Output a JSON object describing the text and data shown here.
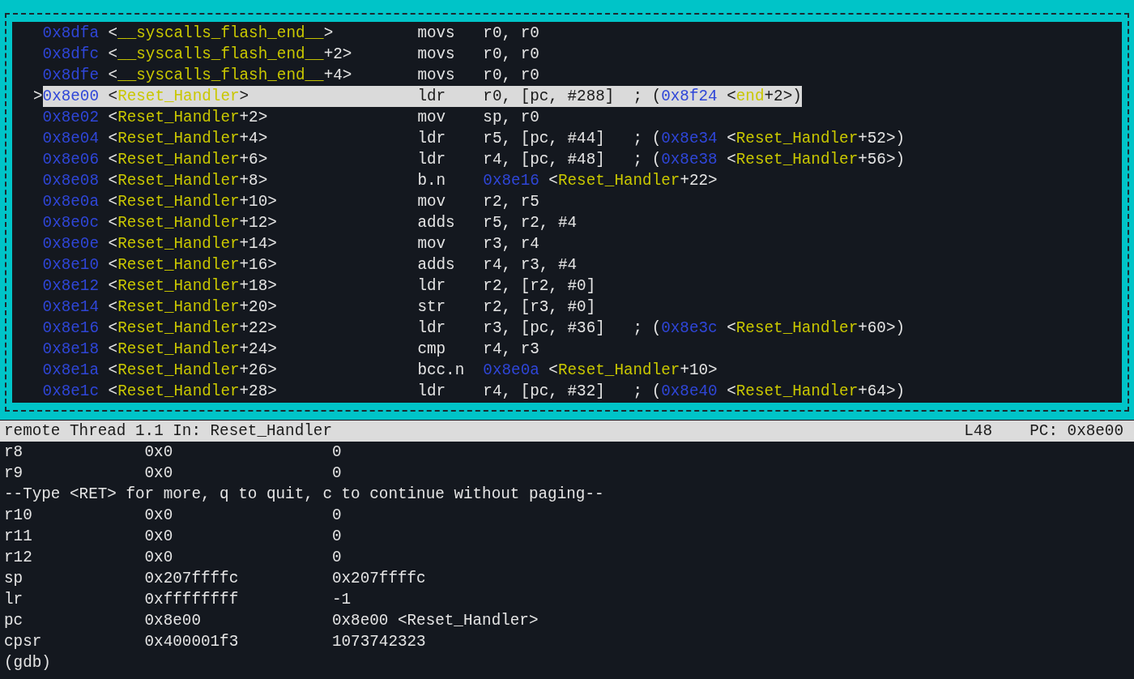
{
  "disassembly": {
    "pointer": ">",
    "rows": [
      {
        "current": false,
        "address": "0x8dfa",
        "symbol": [
          {
            "text": "<",
            "kind": "plain"
          },
          {
            "text": "__syscalls_flash_end__",
            "kind": "sym"
          },
          {
            "text": ">",
            "kind": "plain"
          }
        ],
        "mnemonic": "movs",
        "operands": [
          {
            "text": "r0, r0",
            "kind": "plain"
          }
        ]
      },
      {
        "current": false,
        "address": "0x8dfc",
        "symbol": [
          {
            "text": "<",
            "kind": "plain"
          },
          {
            "text": "__syscalls_flash_end__",
            "kind": "sym"
          },
          {
            "text": "+2>",
            "kind": "plain"
          }
        ],
        "mnemonic": "movs",
        "operands": [
          {
            "text": "r0, r0",
            "kind": "plain"
          }
        ]
      },
      {
        "current": false,
        "address": "0x8dfe",
        "symbol": [
          {
            "text": "<",
            "kind": "plain"
          },
          {
            "text": "__syscalls_flash_end__",
            "kind": "sym"
          },
          {
            "text": "+4>",
            "kind": "plain"
          }
        ],
        "mnemonic": "movs",
        "operands": [
          {
            "text": "r0, r0",
            "kind": "plain"
          }
        ]
      },
      {
        "current": true,
        "address": "0x8e00",
        "symbol": [
          {
            "text": "<",
            "kind": "plain"
          },
          {
            "text": "Reset_Handler",
            "kind": "sym"
          },
          {
            "text": ">",
            "kind": "plain"
          }
        ],
        "mnemonic": "ldr",
        "operands": [
          {
            "text": "r0, [pc, #288]  ; (",
            "kind": "plain"
          },
          {
            "text": "0x8f24",
            "kind": "addr"
          },
          {
            "text": " <",
            "kind": "plain"
          },
          {
            "text": "end",
            "kind": "sym"
          },
          {
            "text": "+2>)",
            "kind": "plain"
          }
        ]
      },
      {
        "current": false,
        "address": "0x8e02",
        "symbol": [
          {
            "text": "<",
            "kind": "plain"
          },
          {
            "text": "Reset_Handler",
            "kind": "sym"
          },
          {
            "text": "+2>",
            "kind": "plain"
          }
        ],
        "mnemonic": "mov",
        "operands": [
          {
            "text": "sp, r0",
            "kind": "plain"
          }
        ]
      },
      {
        "current": false,
        "address": "0x8e04",
        "symbol": [
          {
            "text": "<",
            "kind": "plain"
          },
          {
            "text": "Reset_Handler",
            "kind": "sym"
          },
          {
            "text": "+4>",
            "kind": "plain"
          }
        ],
        "mnemonic": "ldr",
        "operands": [
          {
            "text": "r5, [pc, #44]   ; (",
            "kind": "plain"
          },
          {
            "text": "0x8e34",
            "kind": "addr"
          },
          {
            "text": " <",
            "kind": "plain"
          },
          {
            "text": "Reset_Handler",
            "kind": "sym"
          },
          {
            "text": "+52>)",
            "kind": "plain"
          }
        ]
      },
      {
        "current": false,
        "address": "0x8e06",
        "symbol": [
          {
            "text": "<",
            "kind": "plain"
          },
          {
            "text": "Reset_Handler",
            "kind": "sym"
          },
          {
            "text": "+6>",
            "kind": "plain"
          }
        ],
        "mnemonic": "ldr",
        "operands": [
          {
            "text": "r4, [pc, #48]   ; (",
            "kind": "plain"
          },
          {
            "text": "0x8e38",
            "kind": "addr"
          },
          {
            "text": " <",
            "kind": "plain"
          },
          {
            "text": "Reset_Handler",
            "kind": "sym"
          },
          {
            "text": "+56>)",
            "kind": "plain"
          }
        ]
      },
      {
        "current": false,
        "address": "0x8e08",
        "symbol": [
          {
            "text": "<",
            "kind": "plain"
          },
          {
            "text": "Reset_Handler",
            "kind": "sym"
          },
          {
            "text": "+8>",
            "kind": "plain"
          }
        ],
        "mnemonic": "b.n",
        "operands": [
          {
            "text": "0x8e16",
            "kind": "addr"
          },
          {
            "text": " <",
            "kind": "plain"
          },
          {
            "text": "Reset_Handler",
            "kind": "sym"
          },
          {
            "text": "+22>",
            "kind": "plain"
          }
        ]
      },
      {
        "current": false,
        "address": "0x8e0a",
        "symbol": [
          {
            "text": "<",
            "kind": "plain"
          },
          {
            "text": "Reset_Handler",
            "kind": "sym"
          },
          {
            "text": "+10>",
            "kind": "plain"
          }
        ],
        "mnemonic": "mov",
        "operands": [
          {
            "text": "r2, r5",
            "kind": "plain"
          }
        ]
      },
      {
        "current": false,
        "address": "0x8e0c",
        "symbol": [
          {
            "text": "<",
            "kind": "plain"
          },
          {
            "text": "Reset_Handler",
            "kind": "sym"
          },
          {
            "text": "+12>",
            "kind": "plain"
          }
        ],
        "mnemonic": "adds",
        "operands": [
          {
            "text": "r5, r2, #4",
            "kind": "plain"
          }
        ]
      },
      {
        "current": false,
        "address": "0x8e0e",
        "symbol": [
          {
            "text": "<",
            "kind": "plain"
          },
          {
            "text": "Reset_Handler",
            "kind": "sym"
          },
          {
            "text": "+14>",
            "kind": "plain"
          }
        ],
        "mnemonic": "mov",
        "operands": [
          {
            "text": "r3, r4",
            "kind": "plain"
          }
        ]
      },
      {
        "current": false,
        "address": "0x8e10",
        "symbol": [
          {
            "text": "<",
            "kind": "plain"
          },
          {
            "text": "Reset_Handler",
            "kind": "sym"
          },
          {
            "text": "+16>",
            "kind": "plain"
          }
        ],
        "mnemonic": "adds",
        "operands": [
          {
            "text": "r4, r3, #4",
            "kind": "plain"
          }
        ]
      },
      {
        "current": false,
        "address": "0x8e12",
        "symbol": [
          {
            "text": "<",
            "kind": "plain"
          },
          {
            "text": "Reset_Handler",
            "kind": "sym"
          },
          {
            "text": "+18>",
            "kind": "plain"
          }
        ],
        "mnemonic": "ldr",
        "operands": [
          {
            "text": "r2, [r2, #0]",
            "kind": "plain"
          }
        ]
      },
      {
        "current": false,
        "address": "0x8e14",
        "symbol": [
          {
            "text": "<",
            "kind": "plain"
          },
          {
            "text": "Reset_Handler",
            "kind": "sym"
          },
          {
            "text": "+20>",
            "kind": "plain"
          }
        ],
        "mnemonic": "str",
        "operands": [
          {
            "text": "r2, [r3, #0]",
            "kind": "plain"
          }
        ]
      },
      {
        "current": false,
        "address": "0x8e16",
        "symbol": [
          {
            "text": "<",
            "kind": "plain"
          },
          {
            "text": "Reset_Handler",
            "kind": "sym"
          },
          {
            "text": "+22>",
            "kind": "plain"
          }
        ],
        "mnemonic": "ldr",
        "operands": [
          {
            "text": "r3, [pc, #36]   ; (",
            "kind": "plain"
          },
          {
            "text": "0x8e3c",
            "kind": "addr"
          },
          {
            "text": " <",
            "kind": "plain"
          },
          {
            "text": "Reset_Handler",
            "kind": "sym"
          },
          {
            "text": "+60>)",
            "kind": "plain"
          }
        ]
      },
      {
        "current": false,
        "address": "0x8e18",
        "symbol": [
          {
            "text": "<",
            "kind": "plain"
          },
          {
            "text": "Reset_Handler",
            "kind": "sym"
          },
          {
            "text": "+24>",
            "kind": "plain"
          }
        ],
        "mnemonic": "cmp",
        "operands": [
          {
            "text": "r4, r3",
            "kind": "plain"
          }
        ]
      },
      {
        "current": false,
        "address": "0x8e1a",
        "symbol": [
          {
            "text": "<",
            "kind": "plain"
          },
          {
            "text": "Reset_Handler",
            "kind": "sym"
          },
          {
            "text": "+26>",
            "kind": "plain"
          }
        ],
        "mnemonic": "bcc.n",
        "operands": [
          {
            "text": "0x8e0a",
            "kind": "addr"
          },
          {
            "text": " <",
            "kind": "plain"
          },
          {
            "text": "Reset_Handler",
            "kind": "sym"
          },
          {
            "text": "+10>",
            "kind": "plain"
          }
        ]
      },
      {
        "current": false,
        "address": "0x8e1c",
        "symbol": [
          {
            "text": "<",
            "kind": "plain"
          },
          {
            "text": "Reset_Handler",
            "kind": "sym"
          },
          {
            "text": "+28>",
            "kind": "plain"
          }
        ],
        "mnemonic": "ldr",
        "operands": [
          {
            "text": "r4, [pc, #32]   ; (",
            "kind": "plain"
          },
          {
            "text": "0x8e40",
            "kind": "addr"
          },
          {
            "text": " <",
            "kind": "plain"
          },
          {
            "text": "Reset_Handler",
            "kind": "sym"
          },
          {
            "text": "+64>)",
            "kind": "plain"
          }
        ]
      }
    ]
  },
  "status_bar": {
    "left": "remote Thread 1.1 In: Reset_Handler",
    "line": "L48",
    "pc": "PC: 0x8e00"
  },
  "console": [
    {
      "kind": "register",
      "name": "r8",
      "raw": "0x0",
      "natural": "0"
    },
    {
      "kind": "register",
      "name": "r9",
      "raw": "0x0",
      "natural": "0"
    },
    {
      "kind": "message",
      "text": "--Type <RET> for more, q to quit, c to continue without paging--"
    },
    {
      "kind": "register",
      "name": "r10",
      "raw": "0x0",
      "natural": "0"
    },
    {
      "kind": "register",
      "name": "r11",
      "raw": "0x0",
      "natural": "0"
    },
    {
      "kind": "register",
      "name": "r12",
      "raw": "0x0",
      "natural": "0"
    },
    {
      "kind": "register",
      "name": "sp",
      "raw": "0x207ffffc",
      "natural": "0x207ffffc"
    },
    {
      "kind": "register",
      "name": "lr",
      "raw": "0xffffffff",
      "natural": "-1"
    },
    {
      "kind": "register",
      "name": "pc",
      "raw": "0x8e00",
      "natural": "0x8e00 <Reset_Handler>"
    },
    {
      "kind": "register",
      "name": "cpsr",
      "raw": "0x400001f3",
      "natural": "1073742323"
    },
    {
      "kind": "prompt",
      "text": "(gdb)"
    }
  ]
}
